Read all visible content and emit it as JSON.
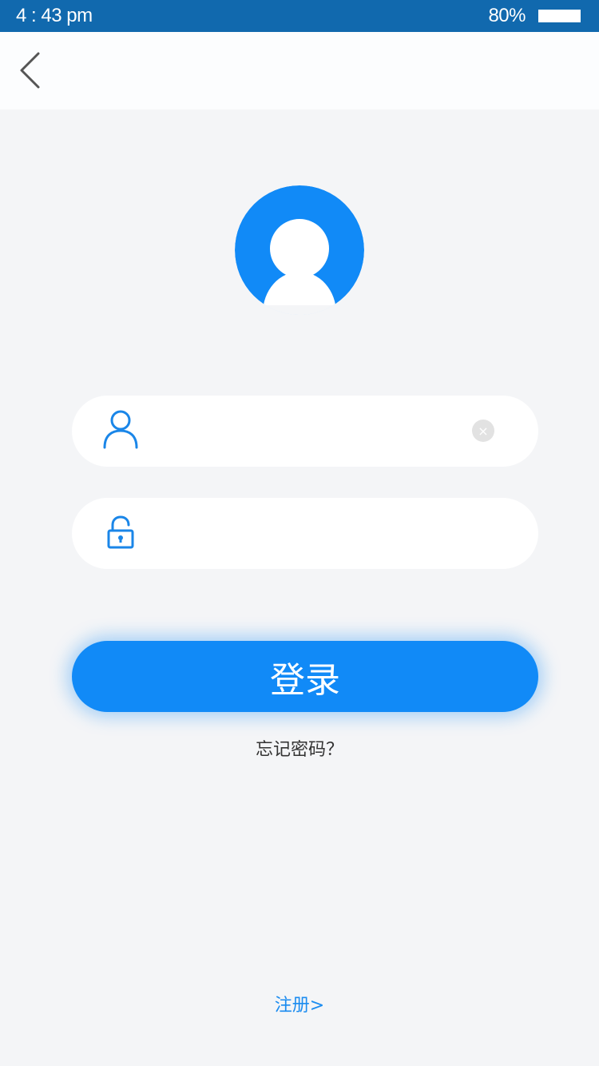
{
  "status_bar": {
    "time": "4 : 43 pm",
    "battery": "80%",
    "background_color": "#1169ae"
  },
  "nav": {
    "back_icon": "chevron-left-icon"
  },
  "avatar": {
    "icon": "user-avatar-icon",
    "color": "#118af7"
  },
  "form": {
    "username": {
      "icon": "user-icon",
      "value": "",
      "placeholder": "",
      "clear_icon": "clear-icon",
      "clear_glyph": "×"
    },
    "password": {
      "icon": "lock-icon",
      "value": "",
      "placeholder": ""
    },
    "login_label": "登录",
    "forgot_label": "忘记密码？",
    "register_label": "注册>"
  },
  "colors": {
    "accent": "#118af7",
    "page_background": "#f4f5f7",
    "link": "#1b8cf0"
  }
}
